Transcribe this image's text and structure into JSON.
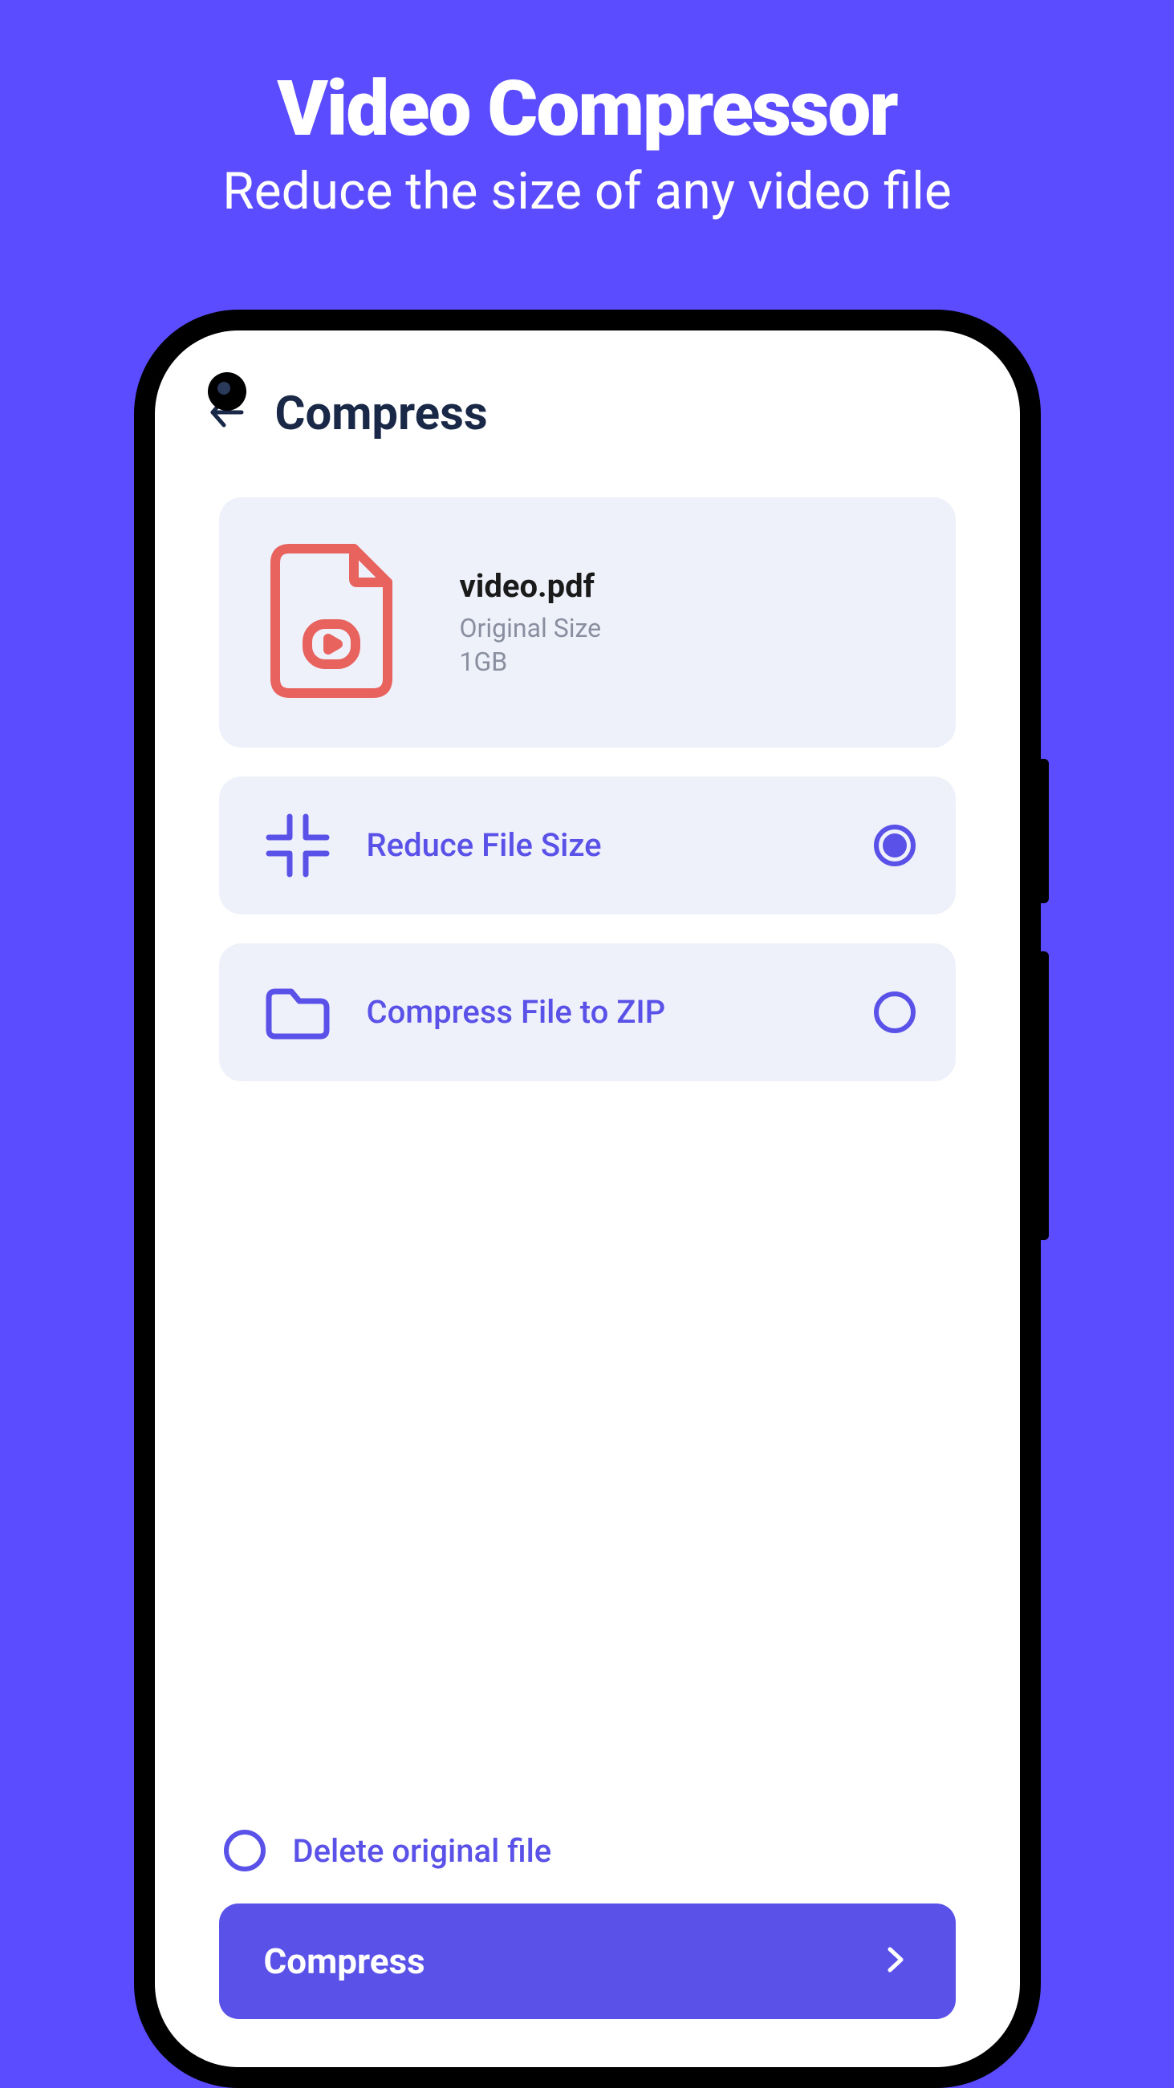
{
  "hero": {
    "title": "Video Compressor",
    "subtitle": "Reduce the size of any video file"
  },
  "app": {
    "screen_title": "Compress",
    "file": {
      "name": "video.pdf",
      "size_label": "Original Size",
      "size_value": "1GB"
    },
    "options": [
      {
        "label": "Reduce File Size",
        "icon": "collapse-icon",
        "selected": true
      },
      {
        "label": "Compress File to ZIP",
        "icon": "folder-icon",
        "selected": false
      }
    ],
    "checkbox": {
      "label": "Delete original file",
      "checked": false
    },
    "cta": "Compress"
  }
}
